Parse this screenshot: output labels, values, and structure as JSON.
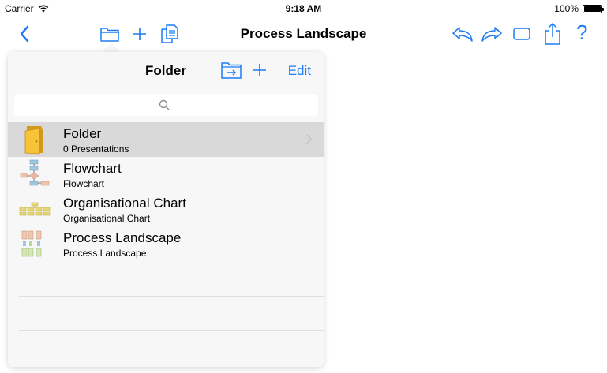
{
  "status_bar": {
    "carrier": "Carrier",
    "time": "9:18 AM",
    "battery": "100%"
  },
  "nav": {
    "title": "Process Landscape",
    "icons": [
      "back-icon",
      "folder-icon",
      "add-icon",
      "copy-icon",
      "undo-icon",
      "redo-icon",
      "present-icon",
      "share-icon",
      "help-icon"
    ],
    "help_label": "?"
  },
  "popover": {
    "title": "Folder",
    "edit_label": "Edit",
    "items": [
      {
        "title": "Folder",
        "subtitle": "0 Presentations",
        "icon": "folder-icon",
        "selected": true
      },
      {
        "title": "Flowchart",
        "subtitle": "Flowchart",
        "icon": "flowchart-thumb"
      },
      {
        "title": "Organisational Chart",
        "subtitle": "Organisational Chart",
        "icon": "orgchart-thumb"
      },
      {
        "title": "Process Landscape",
        "subtitle": "Process Landscape",
        "icon": "process-landscape-thumb"
      }
    ]
  },
  "colors": {
    "accent": "#1a7cf5",
    "selected_row": "#d9d9d9"
  }
}
